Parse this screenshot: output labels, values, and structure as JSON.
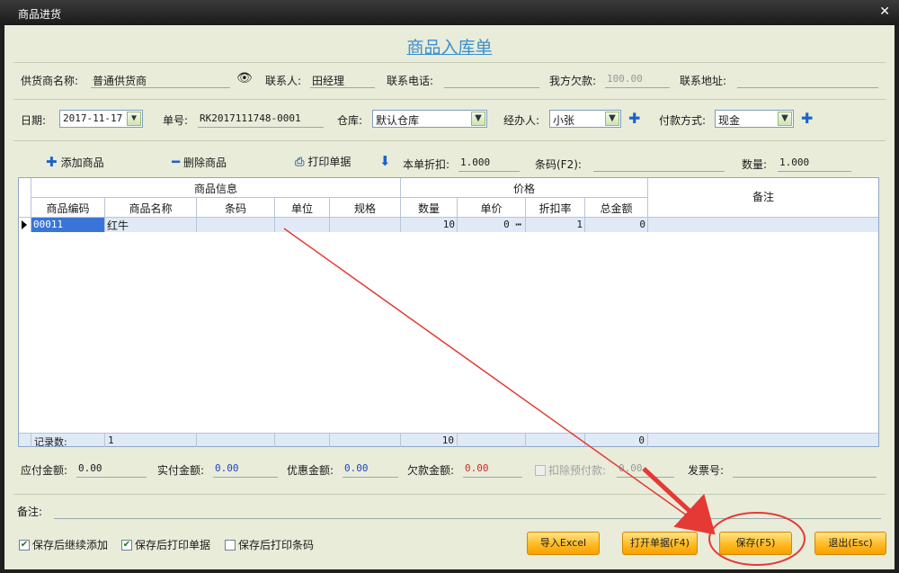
{
  "window": {
    "title": "商品进货",
    "close_glyph": "✕"
  },
  "form": {
    "title": "商品入库单"
  },
  "supplier": {
    "name_label": "供货商名称:",
    "name_value": "普通供货商",
    "contact_label": "联系人:",
    "contact_value": "田经理",
    "phone_label": "联系电话:",
    "phone_value": "",
    "debt_label": "我方欠款:",
    "debt_value": "100.00",
    "address_label": "联系地址:",
    "address_value": ""
  },
  "order": {
    "date_label": "日期:",
    "date_value": "2017-11-17",
    "number_label": "单号:",
    "number_value": "RK2017111748-0001",
    "warehouse_label": "仓库:",
    "warehouse_value": "默认仓库",
    "handler_label": "经办人:",
    "handler_value": "小张",
    "payment_label": "付款方式:",
    "payment_value": "现金"
  },
  "toolbar": {
    "add_label": "添加商品",
    "delete_label": "删除商品",
    "print_label": "打印单据",
    "discount_label": "本单折扣:",
    "discount_value": "1.000",
    "barcode_label": "条码(F2):",
    "barcode_value": "",
    "qty_label": "数量:",
    "qty_value": "1.000"
  },
  "grid": {
    "group_info": "商品信息",
    "group_price": "价格",
    "remark_header": "备注",
    "columns": [
      "商品编码",
      "商品名称",
      "条码",
      "单位",
      "规格",
      "数量",
      "单价",
      "折扣率",
      "总金额"
    ],
    "rows": [
      {
        "code": "00011",
        "name": "红牛",
        "barcode": "",
        "unit": "",
        "spec": "",
        "qty": "10",
        "price": "0",
        "discount": "1",
        "total": "0",
        "remark": ""
      }
    ],
    "footer": {
      "label": "记录数:",
      "count": "1",
      "qty_sum": "10",
      "total_sum": "0"
    }
  },
  "totals": {
    "payable_label": "应付金额:",
    "payable_value": "0.00",
    "paid_label": "实付金额:",
    "paid_value": "0.00",
    "discount_label": "优惠金额:",
    "discount_value": "0.00",
    "owed_label": "欠款金额:",
    "owed_value": "0.00",
    "deduct_label": "扣除预付款:",
    "deduct_value": "0.00",
    "invoice_label": "发票号:",
    "invoice_value": ""
  },
  "remark": {
    "label": "备注:",
    "value": ""
  },
  "options": {
    "continue_add": "保存后继续添加",
    "print_after": "保存后打印单据",
    "print_barcode": "保存后打印条码"
  },
  "buttons": {
    "import_excel": "导入Excel",
    "open_order": "打开单据(F4)",
    "save": "保存(F5)",
    "exit": "退出(Esc)"
  },
  "colors": {
    "accent": "#3b8fd0",
    "button": "#ffba24",
    "annotation": "#e53935",
    "form_bg": "#e8ecd9"
  }
}
